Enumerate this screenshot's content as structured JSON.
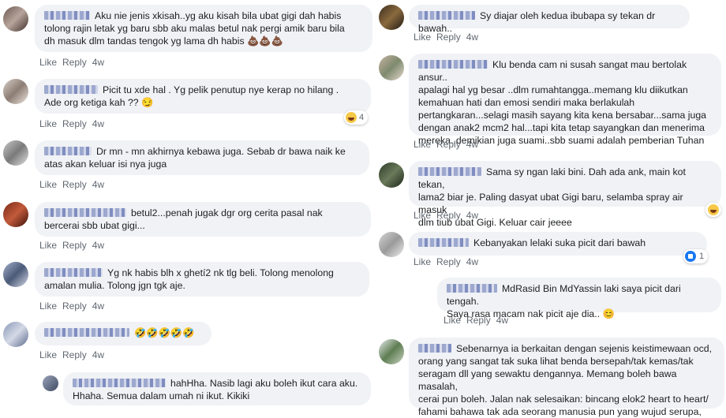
{
  "actions": {
    "like": "Like",
    "reply": "Reply"
  },
  "left": [
    {
      "text": "Aku nie jenis xkisah..yg aku kisah bila ubat gigi dah habis\ntolong rajin letak yg baru sbb aku malas betul nak pergi amik baru bila\ndh masuk dlm tandas tengok yg lama dh habis",
      "emoji": "💩💩💩",
      "time": "4w"
    },
    {
      "text": "Picit tu xde hal . Yg pelik penutup nye kerap no hilang .\nAde org ketiga kah ??",
      "emoji": "😏",
      "time": "4w",
      "reaction": "4"
    },
    {
      "text": "Dr mn - mn akhirnya kebawa juga. Sebab dr bawa naik ke\natas akan keluar isi nya juga",
      "time": "4w"
    },
    {
      "text": "betul2...penah jugak dgr org cerita pasal nak\nbercerai sbb ubat gigi...",
      "time": "4w"
    },
    {
      "text": "Yg nk habis blh x ghetí2 nk tlg beli. Tolong menolong\namalan mulia. Tolong jgn tgk aje.",
      "time": "4w"
    },
    {
      "text": "",
      "emoji": "🤣🤣🤣🤣🤣",
      "time": "4w"
    },
    {
      "text": "hahHha. Nasib lagi aku boleh ikut cara aku.\nHhaha. Semua dalam umah ni ikut. Kikiki"
    }
  ],
  "right": [
    {
      "text": "Sy diajar oleh kedua ibubapa sy tekan dr bawah..",
      "time": "4w"
    },
    {
      "text": "Klu benda cam ni susah sangat mau bertolak ansur..\napalagi hal yg besar ..dlm rumahtangga..memang klu diikutkan\nkemahuan hati dan emosi sendiri maka berlakulah\npertangkaran...selagi masih sayang kita kena bersabar...sama juga\ndengan anak2 mcm2 hal...tapi kita tetap sayangkan dan menerima\nmereka..demikian juga suami..sbb suami adalah pemberian Tuhan",
      "time": "4w"
    },
    {
      "text": "Sama sy ngan laki bini. Dah ada ank, main kot tekan,\nlama2 biar je. Paling dasyat ubat Gigi baru, selamba spray air masuk\ndlm tiub ubat Gigi. Keluar cair jeeee",
      "time": "4w"
    },
    {
      "text": "Kebanyakan lelaki suka picit dari bawah",
      "time": "4w",
      "reaction": "1"
    },
    {
      "text": "MdRasid Bin MdYassin laki saya picit dari tengah.\nSaya rasa macam nak picit aje dia..",
      "emoji": "😊",
      "time": "4w"
    },
    {
      "text": "Sebenarnya ia berkaitan dengan sejenis keistimewaan ocd,\norang yang sangat tak suka lihat benda bersepah/tak kemas/tak\nseragam dll yang sewaktu dengannya. Memang boleh bawa masalah,\ncerai pun boleh. Jalan nak selesaikan: bincang elok2 heart to heart/\nfahami bahawa tak ada seorang manusia pun yang wujud serupa,"
    }
  ],
  "colors": {
    "bubble": "#f0f2f5",
    "text": "#1c1e21",
    "meta": "#606770",
    "like_blue": "#1877f2"
  }
}
